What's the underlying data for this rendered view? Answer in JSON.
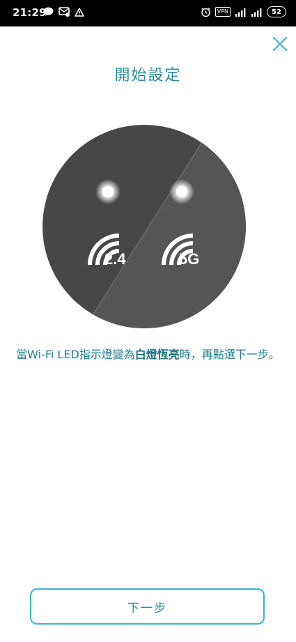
{
  "status_bar": {
    "time": "21:29",
    "vpn_label": "VPN",
    "battery_level": "52",
    "left_icons": [
      "line-icon",
      "msg-icon",
      "warning-icon"
    ],
    "right_icons": [
      "alarm-icon",
      "vpn-badge",
      "signal-icon",
      "signal-icon",
      "battery-icon"
    ]
  },
  "header": {
    "title": "開始設定",
    "close_icon": "close-icon"
  },
  "illustration": {
    "band_24_label": "2.4",
    "band_5g_label": "5G",
    "device_color": "#4a4a4a"
  },
  "instruction": {
    "part1": "當Wi-Fi LED指示燈變為",
    "emphasis": "白燈恆亮",
    "part2": "時，再點選下一步。"
  },
  "footer": {
    "next_label": "下一步"
  },
  "colors": {
    "accent": "#2a8ea0",
    "button_border": "#37b6c9"
  }
}
